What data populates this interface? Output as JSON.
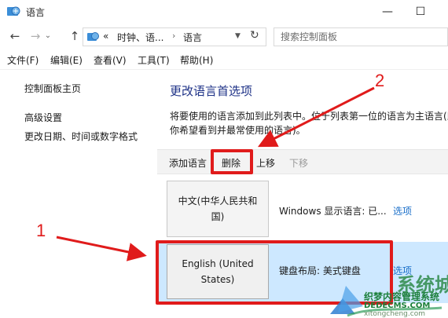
{
  "window": {
    "title": "语言",
    "minimize_glyph": "—",
    "maximize_glyph": "☐"
  },
  "address_bar": {
    "overflow": "«",
    "crumbs": [
      "时钟、语...",
      "语言"
    ],
    "search_placeholder": "搜索控制面板"
  },
  "menu": {
    "items": [
      "文件(F)",
      "编辑(E)",
      "查看(V)",
      "工具(T)",
      "帮助(H)"
    ]
  },
  "left_nav": {
    "home": "控制面板主页",
    "advanced": "高级设置",
    "datetime": "更改日期、时间或数字格式"
  },
  "main": {
    "title": "更改语言首选项",
    "description_line1": "将要使用的语言添加到此列表中。位于列表第一位的语言为主语言(即",
    "description_line2": "你希望看到并最常使用的语言)。"
  },
  "toolbar": {
    "add": "添加语言",
    "remove": "删除",
    "up": "上移",
    "down": "下移"
  },
  "languages": [
    {
      "name": "中文(中华人民共和国)",
      "info": "Windows 显示语言: 已...",
      "options": "选项",
      "selected": false
    },
    {
      "name": "English (United States)",
      "info": "键盘布局: 美式键盘",
      "options": "选项",
      "selected": true
    }
  ],
  "annotations": {
    "label_1": "1",
    "label_2": "2",
    "color": "#e01b1b"
  },
  "watermark": {
    "big": "系统城",
    "line1": "织梦内容管理系统",
    "line2": "DEDECMS.COM",
    "url": "xitongcheng.com"
  },
  "colors": {
    "title_blue": "#1e3287",
    "link_blue": "#1a6fc9",
    "selected_row": "#cde8ff"
  }
}
